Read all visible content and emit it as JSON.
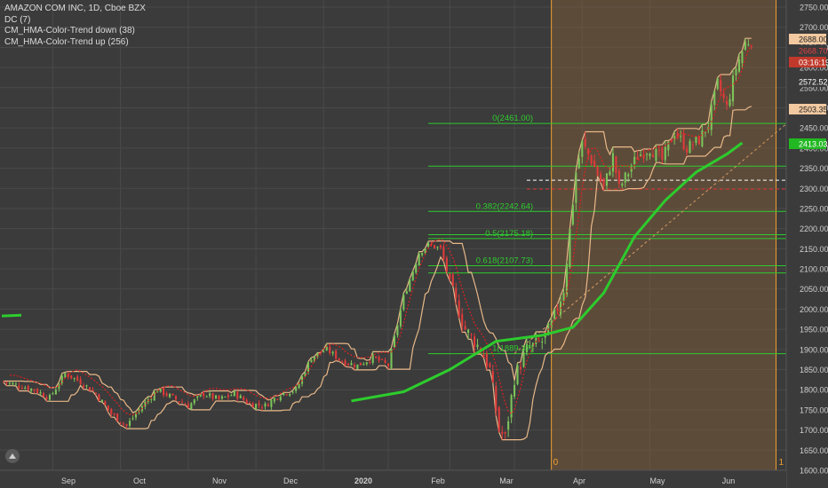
{
  "header": {
    "symbol_line": "AMAZON COM INC, 1D, Cboe BZX",
    "indicators": [
      "DC (7)",
      "CM_HMA-Color-Trend down (38)",
      "CM_HMA-Color-Trend up (256)"
    ]
  },
  "price_tags": [
    {
      "text": "2688.00",
      "value": 2688,
      "bg": "#f2c9a0",
      "fg": "#222222"
    },
    {
      "text": "2668.70",
      "value": 2668.7,
      "bg": "#3b3b3b",
      "fg": "#e04040"
    },
    {
      "text": "03:16:19",
      "value": 2646,
      "bg": "#c0392b",
      "fg": "#ffffff"
    },
    {
      "text": "2572.52",
      "value": 2572.52,
      "bg": "#3b3b3b",
      "fg": "#ffffff"
    },
    {
      "text": "2503.35",
      "value": 2503.35,
      "bg": "#f2c9a0",
      "fg": "#222222"
    },
    {
      "text": "2413.03",
      "value": 2413.03,
      "bg": "#22b822",
      "fg": "#ffffff"
    }
  ],
  "fib_labels": [
    {
      "text": "0(2461.00)",
      "value": 2461
    },
    {
      "text": "0.382(2242.64)",
      "value": 2242.64
    },
    {
      "text": "0.5(2175.18)",
      "value": 2175.18
    },
    {
      "text": "0.618(2107.73)",
      "value": 2107.73
    },
    {
      "text": "1(1889.37)",
      "value": 1889.37
    }
  ],
  "extra_green_levels": [
    2355,
    2185,
    2090
  ],
  "time_markers": [
    "0",
    "1"
  ],
  "colors": {
    "up": "#7cc45a",
    "down": "#e03b3b",
    "channel": "#e8b888",
    "fib": "#2ecc2e",
    "hma_up": "#2dcc2d",
    "hma_down": "#e02020",
    "region": "#7a5a3a",
    "time_line": "#f0a030"
  },
  "chart_data": {
    "type": "candlestick",
    "ylim": [
      1600,
      2750
    ],
    "y_ticks": [
      1600,
      1650,
      1700,
      1750,
      1800,
      1850,
      1900,
      1950,
      2000,
      2050,
      2100,
      2150,
      2200,
      2250,
      2300,
      2350,
      2400,
      2450,
      2500,
      2550,
      2600,
      2650,
      2700,
      2750
    ],
    "x_ticks": [
      "Sep",
      "Oct",
      "Nov",
      "Dec",
      "2020",
      "Feb",
      "Mar",
      "Apr",
      "May",
      "Jun"
    ],
    "anchor_closes": [
      [
        0,
        1820
      ],
      [
        10,
        1800
      ],
      [
        15,
        1780
      ],
      [
        20,
        1840
      ],
      [
        25,
        1820
      ],
      [
        30,
        1790
      ],
      [
        35,
        1740
      ],
      [
        40,
        1710
      ],
      [
        45,
        1760
      ],
      [
        50,
        1800
      ],
      [
        55,
        1780
      ],
      [
        60,
        1760
      ],
      [
        65,
        1790
      ],
      [
        70,
        1775
      ],
      [
        75,
        1790
      ],
      [
        80,
        1765
      ],
      [
        85,
        1760
      ],
      [
        90,
        1790
      ],
      [
        95,
        1800
      ],
      [
        100,
        1880
      ],
      [
        105,
        1900
      ],
      [
        110,
        1870
      ],
      [
        115,
        1860
      ],
      [
        120,
        1880
      ],
      [
        125,
        1860
      ],
      [
        130,
        2030
      ],
      [
        135,
        2140
      ],
      [
        138,
        2160
      ],
      [
        142,
        2150
      ],
      [
        146,
        2040
      ],
      [
        150,
        1950
      ],
      [
        155,
        1900
      ],
      [
        158,
        1850
      ],
      [
        161,
        1700
      ],
      [
        163,
        1680
      ],
      [
        166,
        1830
      ],
      [
        170,
        1900
      ],
      [
        175,
        1920
      ],
      [
        178,
        1960
      ],
      [
        182,
        2050
      ],
      [
        186,
        2340
      ],
      [
        188,
        2410
      ],
      [
        191,
        2370
      ],
      [
        195,
        2300
      ],
      [
        198,
        2380
      ],
      [
        200,
        2300
      ],
      [
        203,
        2340
      ],
      [
        206,
        2380
      ],
      [
        210,
        2400
      ],
      [
        214,
        2370
      ],
      [
        218,
        2440
      ],
      [
        222,
        2400
      ],
      [
        226,
        2420
      ],
      [
        229,
        2460
      ],
      [
        232,
        2560
      ],
      [
        235,
        2500
      ],
      [
        238,
        2600
      ],
      [
        241,
        2660
      ],
      [
        243,
        2668.7
      ]
    ],
    "hma_up": [
      [
        113,
        1772
      ],
      [
        130,
        1795
      ],
      [
        145,
        1850
      ],
      [
        160,
        1920
      ],
      [
        175,
        1935
      ],
      [
        185,
        1955
      ],
      [
        195,
        2040
      ],
      [
        205,
        2180
      ],
      [
        215,
        2270
      ],
      [
        225,
        2340
      ],
      [
        235,
        2385
      ],
      [
        240,
        2413
      ]
    ],
    "hma_down_visible_from_bar": 0,
    "fib_range": [
      1889.37,
      2461
    ],
    "fib_region_start_bar": 178
  }
}
